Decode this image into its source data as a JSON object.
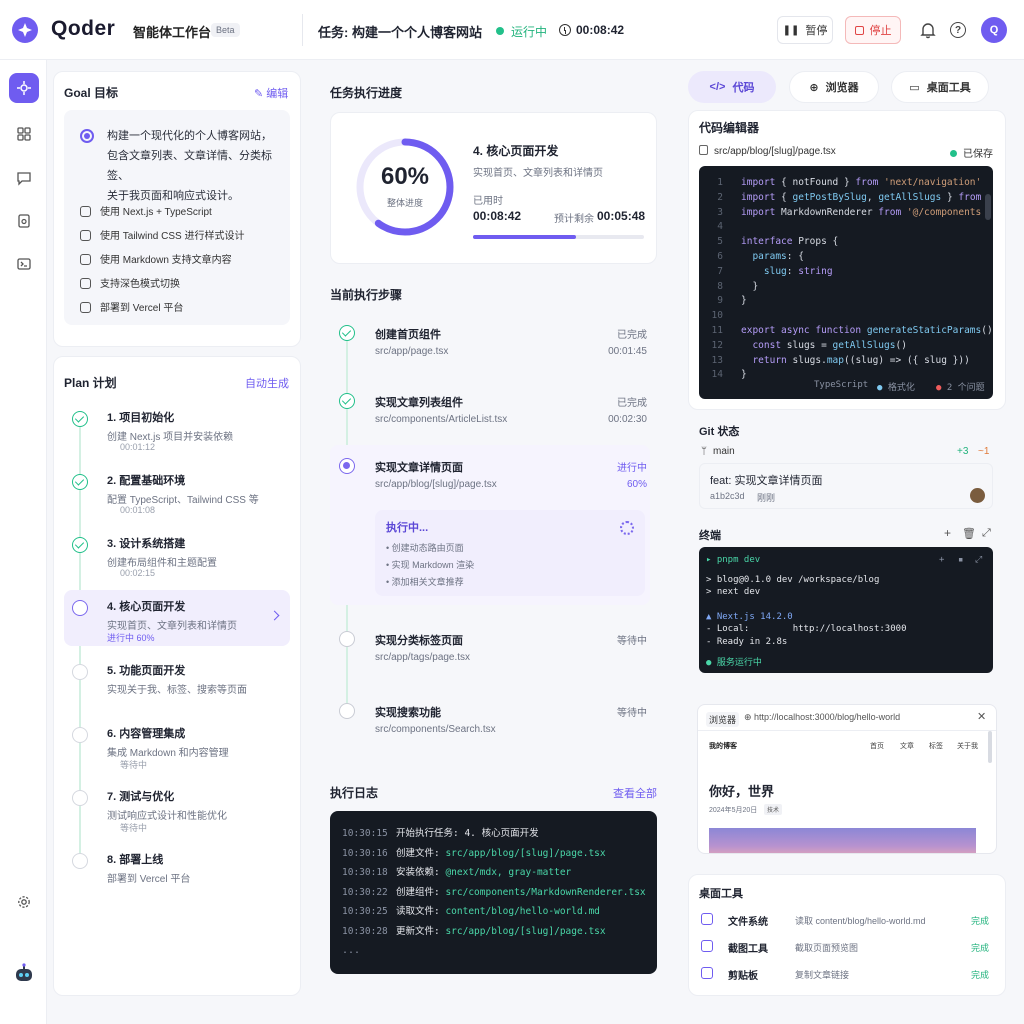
{
  "app": {
    "brand": "Qoder",
    "subtitle": "智能体工作台",
    "beta": "Beta"
  },
  "task": {
    "title": "任务: 构建一个个人博客网站",
    "status": "运行中",
    "timer": "00:08:42"
  },
  "actions": {
    "pause": "暂停",
    "stop": "停止",
    "avatar": "Q"
  },
  "goal": {
    "title": "Goal 目标",
    "edit": "编辑",
    "lines": [
      "构建一个现代化的个人博客网站，",
      "包含文章列表、文章详情、分类标签、",
      "关于我页面和响应式设计。"
    ],
    "features": [
      "使用 Next.js + TypeScript",
      "使用 Tailwind CSS 进行样式设计",
      "使用 Markdown 支持文章内容",
      "支持深色模式切换",
      "部署到 Vercel 平台"
    ]
  },
  "plan": {
    "title": "Plan 计划",
    "auto": "自动生成",
    "steps": [
      {
        "title": "1. 项目初始化",
        "desc": "创建 Next.js 项目并安装依赖",
        "meta": "00:01:12",
        "state": "done"
      },
      {
        "title": "2. 配置基础环境",
        "desc": "配置 TypeScript、Tailwind CSS 等",
        "meta": "00:01:08",
        "state": "done"
      },
      {
        "title": "3. 设计系统搭建",
        "desc": "创建布局组件和主题配置",
        "meta": "00:02:15",
        "state": "done"
      },
      {
        "title": "4. 核心页面开发",
        "desc": "实现首页、文章列表和详情页",
        "meta": "进行中 60%",
        "state": "cur"
      },
      {
        "title": "5. 功能页面开发",
        "desc": "实现关于我、标签、搜索等页面",
        "meta": "",
        "state": "wait"
      },
      {
        "title": "6. 内容管理集成",
        "desc": "集成 Markdown 和内容管理",
        "meta": "等待中",
        "state": "wait"
      },
      {
        "title": "7. 测试与优化",
        "desc": "测试响应式设计和性能优化",
        "meta": "等待中",
        "state": "wait"
      },
      {
        "title": "8. 部署上线",
        "desc": "部署到 Vercel 平台",
        "meta": "",
        "state": "wait"
      }
    ]
  },
  "progress": {
    "title": "任务执行进度",
    "percent": "60%",
    "percent_value": 0.6,
    "overall": "整体进度",
    "stage": "4. 核心页面开发",
    "stage_desc": "实现首页、文章列表和详情页",
    "elapsed_label": "已用时",
    "elapsed": "00:08:42",
    "remaining_label": "预计剩余",
    "remaining": "00:05:48",
    "bar_value": 0.6
  },
  "steps": {
    "title": "当前执行步骤",
    "items": [
      {
        "name": "创建首页组件",
        "file": "src/app/page.tsx",
        "status": "已完成",
        "time": "00:01:45",
        "state": "done"
      },
      {
        "name": "实现文章列表组件",
        "file": "src/components/ArticleList.tsx",
        "status": "已完成",
        "time": "00:02:30",
        "state": "done"
      },
      {
        "name": "实现文章详情页面",
        "file": "src/app/blog/[slug]/page.tsx",
        "status": "进行中",
        "time": "60%",
        "state": "cur"
      },
      {
        "name": "实现分类标签页面",
        "file": "src/app/tags/page.tsx",
        "status": "等待中",
        "time": "",
        "state": "wait"
      },
      {
        "name": "实现搜索功能",
        "file": "src/components/Search.tsx",
        "status": "等待中",
        "time": "",
        "state": "wait"
      }
    ],
    "exec": {
      "heading": "执行中...",
      "items": [
        "• 创建动态路由页面",
        "• 实现 Markdown 渲染",
        "• 添加相关文章推荐"
      ]
    }
  },
  "log": {
    "title": "执行日志",
    "view_all": "查看全部",
    "rows": [
      {
        "ts": "10:30:15",
        "action": "开始执行任务: 4. 核心页面开发",
        "file": ""
      },
      {
        "ts": "10:30:16",
        "action": "创建文件: ",
        "file": "src/app/blog/[slug]/page.tsx"
      },
      {
        "ts": "10:30:18",
        "action": "安装依赖: ",
        "file": "@next/mdx, gray-matter"
      },
      {
        "ts": "10:30:22",
        "action": "创建组件: ",
        "file": "src/components/MarkdownRenderer.tsx"
      },
      {
        "ts": "10:30:25",
        "action": "读取文件: ",
        "file": "content/blog/hello-world.md"
      },
      {
        "ts": "10:30:28",
        "action": "更新文件: ",
        "file": "src/app/blog/[slug]/page.tsx"
      }
    ],
    "more": "..."
  },
  "tabs": [
    "代码",
    "浏览器",
    "桌面工具"
  ],
  "editor": {
    "title": "代码编辑器",
    "file": "src/app/blog/[slug]/page.tsx",
    "saved": "已保存",
    "lang": "TypeScript",
    "format": "格式化",
    "problems": "2 个问题"
  },
  "git": {
    "title": "Git 状态",
    "branch": "main",
    "added": "+3",
    "changed": "~1",
    "commit_msg": "feat: 实现文章详情页面",
    "hash": "a1b2c3d",
    "when": "刚刚"
  },
  "terminal": {
    "title": "终端",
    "tab": "pnpm dev",
    "lines": [
      "> blog@0.1.0 dev /workspace/blog",
      "> next dev",
      "",
      "▲ Next.js 14.2.0",
      "- Local:        http://localhost:3000",
      "- Ready in 2.8s"
    ],
    "running": "服务运行中"
  },
  "browser": {
    "tab": "浏览器",
    "url": "http://localhost:3000/blog/hello-world",
    "site": "我的博客",
    "nav": [
      "首页",
      "文章",
      "标签",
      "关于我"
    ],
    "post_title": "你好，世界",
    "post_date": "2024年5月20日",
    "post_tag": "技术"
  },
  "desktop": {
    "title": "桌面工具",
    "items": [
      {
        "name": "文件系统",
        "desc": "读取 content/blog/hello-world.md",
        "status": "完成"
      },
      {
        "name": "截图工具",
        "desc": "截取页面预览图",
        "status": "完成"
      },
      {
        "name": "剪贴板",
        "desc": "复制文章链接",
        "status": "完成"
      }
    ]
  },
  "colors": {
    "accent": "#6f5cf0",
    "success": "#22c08a",
    "danger": "#e04545",
    "code_bg": "#151a22"
  }
}
